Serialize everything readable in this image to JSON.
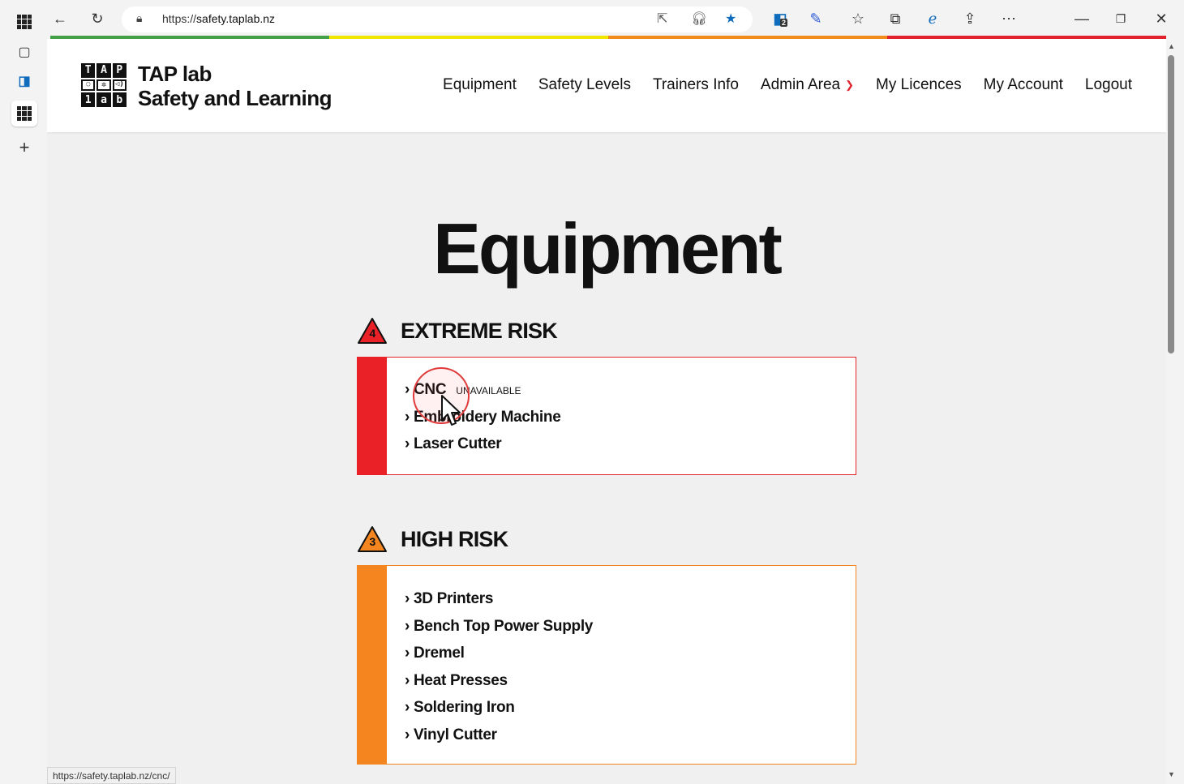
{
  "browser": {
    "url_prefix": "https://",
    "url_host": "safety.taplab.nz",
    "status_url": "https://safety.taplab.nz/cnc/",
    "badge_count": "2",
    "progress_colors": [
      "#43a047",
      "#f0e600",
      "#f08c1c",
      "#e0232c"
    ]
  },
  "site": {
    "logo_cells": [
      "T",
      "A",
      "P",
      "",
      "",
      "",
      "1",
      "a",
      "b"
    ],
    "title_line1": "TAP lab",
    "title_line2": "Safety and Learning",
    "nav": [
      "Equipment",
      "Safety Levels",
      "Trainers Info",
      "Admin Area",
      "My Licences",
      "My Account",
      "Logout"
    ]
  },
  "page": {
    "title": "Equipment",
    "sections": [
      {
        "level": "4",
        "heading": "EXTREME RISK",
        "color": "#ea2127",
        "items": [
          "› CNC",
          "› Embroidery Machine",
          "› Laser Cutter"
        ],
        "unavailable_label": "UNAVAILABLE"
      },
      {
        "level": "3",
        "heading": "HIGH RISK",
        "color": "#f5861f",
        "items": [
          "› 3D Printers",
          "› Bench Top Power Supply",
          "› Dremel",
          "› Heat Presses",
          "› Soldering Iron",
          "› Vinyl Cutter"
        ]
      }
    ]
  }
}
